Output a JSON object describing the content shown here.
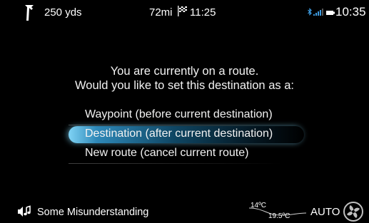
{
  "status_bar": {
    "turn_icon": "turn-left-arrow-icon",
    "distance": "250 yds",
    "remaining": "72mi",
    "flag_icon": "checkered-flag-icon",
    "eta": "11:25",
    "bluetooth_icon": "bluetooth-icon",
    "signal_icon": "signal-strength-icon",
    "battery_icon": "battery-icon",
    "clock": "10:35"
  },
  "dialog": {
    "line1": "You are currently on a route.",
    "line2": "Would you like to set this destination as a:",
    "options": [
      {
        "label": "Waypoint (before current destination)",
        "selected": false
      },
      {
        "label": "Destination (after current destination)",
        "selected": true
      },
      {
        "label": "New route (cancel current route)",
        "selected": false
      }
    ],
    "highlight_color": "#2e88b8"
  },
  "bottom_bar": {
    "audio_icon": "audio-source-icon",
    "track": "Some Misunderstanding",
    "outside_temp": "14ºC",
    "cabin_temp": "19.5ºC",
    "climate_mode": "AUTO",
    "fan_icon": "fan-icon"
  }
}
